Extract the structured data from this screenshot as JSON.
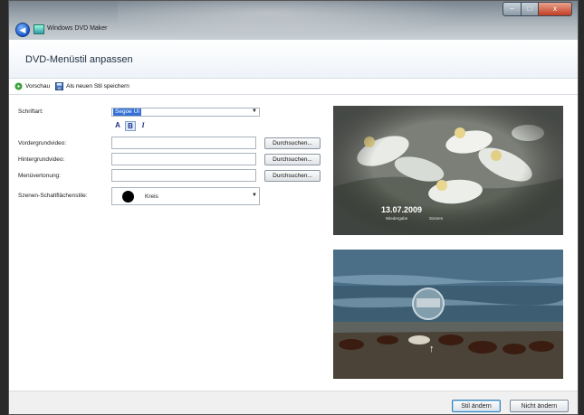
{
  "window": {
    "title": "Windows DVD Maker",
    "min": "–",
    "max": "□",
    "close": "x"
  },
  "header": {
    "title": "DVD-Menüstil anpassen"
  },
  "toolbar": {
    "preview": "Vorschau",
    "save_as_new": "Als neuen Stil speichern"
  },
  "form": {
    "font_label": "Schriftart:",
    "font_value": "Segoe UI",
    "format_a": "A",
    "format_b": "B",
    "format_i": "I",
    "foreground_video_label": "Vordergrundvideo:",
    "background_video_label": "Hintergrundvideo:",
    "menu_audio_label": "Menüvertonung:",
    "browse": "Durchsuchen...",
    "scene_button_style_label": "Szenen-Schaltflächenstile:",
    "scene_button_style_value": "Kreis",
    "dropdown_arrow": "▼"
  },
  "preview": {
    "date": "13.07.2009",
    "menu_play": "Wiedergabe",
    "menu_scenes": "Szenen",
    "up_arrow": "↑"
  },
  "footer": {
    "ok": "Stil ändern",
    "cancel": "Nicht ändern"
  },
  "colors": {
    "accent": "#3470d6",
    "header_bg": "#eef3f9",
    "footer_bg": "#f0f0f0"
  },
  "icons": {
    "back": "back-arrow-icon",
    "app": "dvd-maker-icon",
    "preview": "play-icon",
    "save": "floppy-icon"
  }
}
